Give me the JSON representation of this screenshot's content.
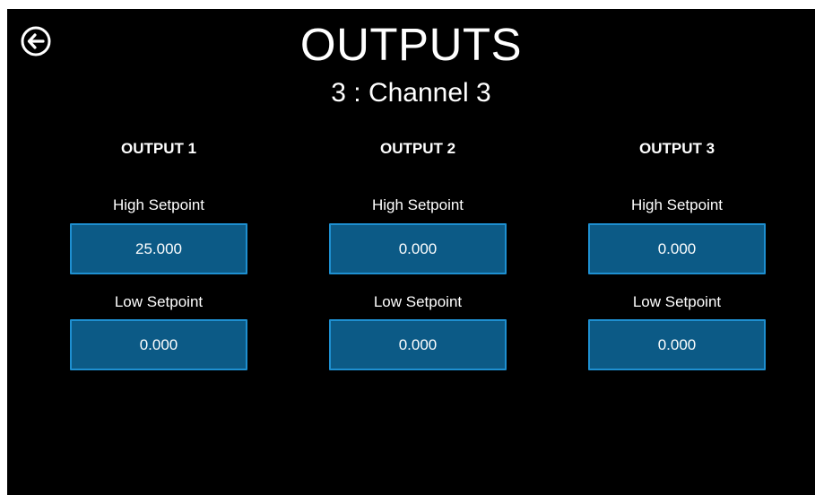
{
  "header": {
    "title": "OUTPUTS",
    "subtitle": "3 : Channel 3",
    "back_icon": "arrow-left-circle-icon"
  },
  "colors": {
    "background": "#000000",
    "field_fill": "#0c5a86",
    "field_border": "#1e8fd0",
    "text": "#ffffff"
  },
  "outputs": [
    {
      "heading": "OUTPUT 1",
      "high_label": "High Setpoint",
      "high_value": "25.000",
      "low_label": "Low Setpoint",
      "low_value": "0.000"
    },
    {
      "heading": "OUTPUT 2",
      "high_label": "High Setpoint",
      "high_value": "0.000",
      "low_label": "Low Setpoint",
      "low_value": "0.000"
    },
    {
      "heading": "OUTPUT 3",
      "high_label": "High Setpoint",
      "high_value": "0.000",
      "low_label": "Low Setpoint",
      "low_value": "0.000"
    }
  ]
}
